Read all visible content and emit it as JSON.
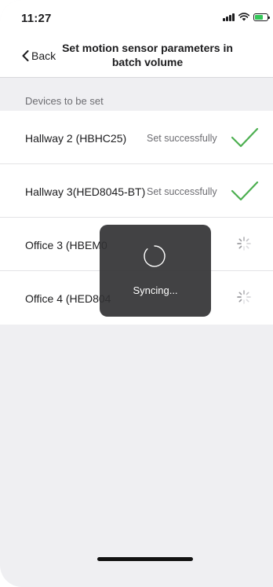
{
  "status_bar": {
    "time": "11:27",
    "icons": [
      "signal-icon",
      "wifi-icon",
      "battery-charging-icon"
    ]
  },
  "nav": {
    "back_label": "Back",
    "title": "Set motion sensor parameters in batch volume"
  },
  "section": {
    "header": "Devices to be set"
  },
  "devices": [
    {
      "name": "Hallway 2 (HBHC25)",
      "status": "Set successfully",
      "state": "success"
    },
    {
      "name": "Hallway 3(HED8045-BT)",
      "status": "Set successfully",
      "state": "success"
    },
    {
      "name": "Office 3 (HBEM0",
      "status": "",
      "state": "loading"
    },
    {
      "name": "Office 4 (HED804",
      "status": "",
      "state": "loading"
    }
  ],
  "toast": {
    "label": "Syncing..."
  },
  "colors": {
    "success_check": "#4caf50",
    "toast_bg": "#323234",
    "background": "#efeff2"
  }
}
